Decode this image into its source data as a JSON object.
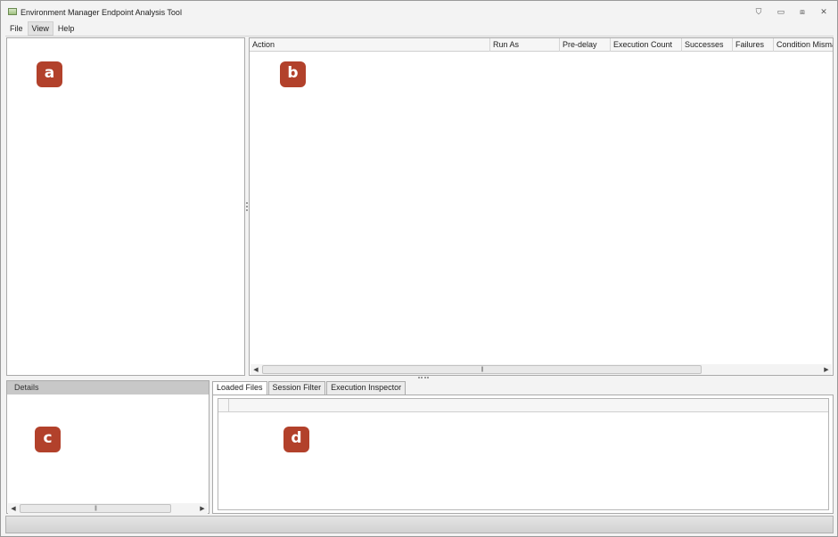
{
  "window": {
    "title": "Environment Manager Endpoint Analysis Tool",
    "controls": {
      "pin": "⛉",
      "minimize": "▭",
      "restore": "⧈",
      "close": "✕"
    }
  },
  "menu": {
    "items": [
      "File",
      "View",
      "Help"
    ]
  },
  "actions_table": {
    "columns": [
      "Action",
      "Run As",
      "Pre-delay",
      "Execution Count",
      "Successes",
      "Failures",
      "Condition Mismatch"
    ]
  },
  "details": {
    "header": "Details"
  },
  "bottom_tabs": {
    "tabs": [
      "Loaded Files",
      "Session Filter",
      "Execution Inspector"
    ],
    "active": "Loaded Files"
  },
  "scrollbar": {
    "left_arrow": "◀",
    "right_arrow": "▶",
    "grip": "|||"
  },
  "callouts": {
    "a": "a",
    "b": "b",
    "c": "c",
    "d": "d"
  },
  "colors": {
    "callout_bg": "#b2412b",
    "details_header_bg": "#c8c8c8",
    "panel_bg": "#ffffff"
  }
}
